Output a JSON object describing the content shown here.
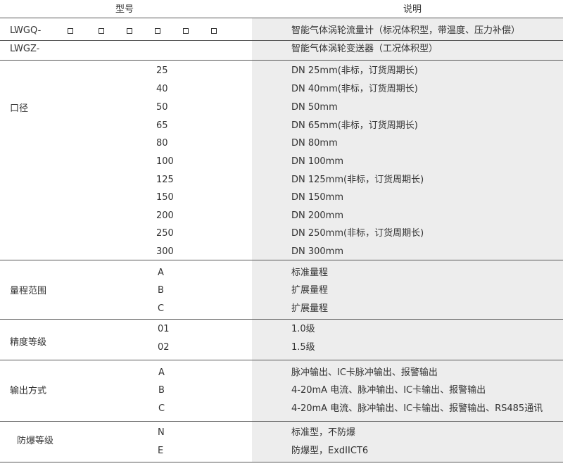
{
  "header": {
    "model_col": "型号",
    "desc_col": "说明"
  },
  "models": [
    {
      "code": "LWGQ-",
      "desc": "智能气体涡轮流量计（标况体积型，带温度、压力补偿）"
    },
    {
      "code": "LWGZ-",
      "desc": "智能气体涡轮变送器（工况体积型）"
    }
  ],
  "sections": [
    {
      "name": "口径",
      "rows": [
        {
          "code": "25",
          "desc": "DN 25mm(非标，订货周期长)"
        },
        {
          "code": "40",
          "desc": "DN 40mm(非标，订货周期长)"
        },
        {
          "code": "50",
          "desc": "DN 50mm"
        },
        {
          "code": "65",
          "desc": "DN 65mm(非标，订货周期长)"
        },
        {
          "code": "80",
          "desc": "DN 80mm"
        },
        {
          "code": "100",
          "desc": "DN 100mm"
        },
        {
          "code": "125",
          "desc": "DN 125mm(非标，订货周期长)"
        },
        {
          "code": "150",
          "desc": "DN 150mm"
        },
        {
          "code": "200",
          "desc": "DN 200mm"
        },
        {
          "code": "250",
          "desc": "DN 250mm(非标，订货周期长)"
        },
        {
          "code": "300",
          "desc": "DN 300mm"
        }
      ]
    },
    {
      "name": "量程范围",
      "rows": [
        {
          "code": "A",
          "desc": "标准量程"
        },
        {
          "code": "B",
          "desc": "扩展量程"
        },
        {
          "code": "C",
          "desc": "扩展量程"
        }
      ]
    },
    {
      "name": "精度等级",
      "rows": [
        {
          "code": "01",
          "desc": "1.0级"
        },
        {
          "code": "02",
          "desc": "1.5级"
        }
      ]
    },
    {
      "name": "输出方式",
      "rows": [
        {
          "code": "A",
          "desc": "脉冲输出、IC卡脉冲输出、报警输出"
        },
        {
          "code": "B",
          "desc": "4-20mA 电流、脉冲输出、IC卡输出、报警输出"
        },
        {
          "code": "C",
          "desc": "4-20mA 电流、脉冲输出、IC卡输出、报警输出、RS485通讯"
        }
      ]
    },
    {
      "name": "防爆等级",
      "rows": [
        {
          "code": "N",
          "desc": "标准型，不防爆"
        },
        {
          "code": "E",
          "desc": "防爆型，ExdIICT6"
        }
      ]
    }
  ]
}
